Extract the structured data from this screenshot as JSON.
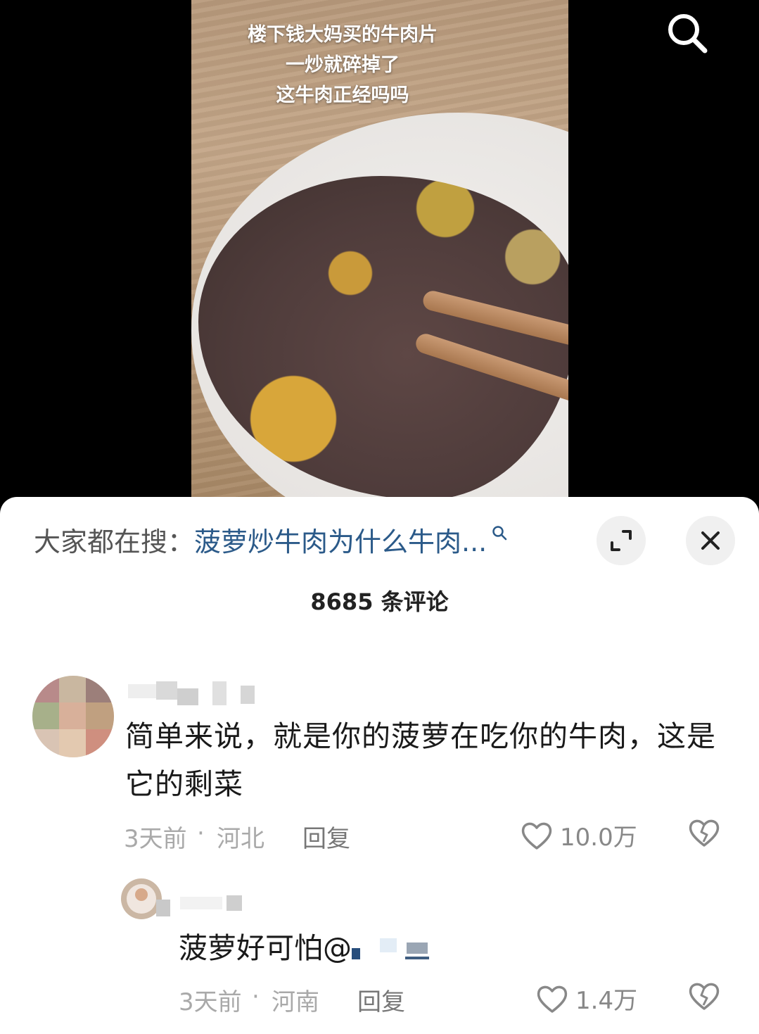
{
  "video": {
    "caption_lines": [
      "楼下钱大妈买的牛肉片",
      "一炒就碎掉了",
      "这牛肉正经吗吗"
    ]
  },
  "search_bar": {
    "prefix": "大家都在搜：",
    "query": "菠萝炒牛肉为什么牛肉..."
  },
  "comments_header": {
    "count_text": "8685 条评论"
  },
  "comments": [
    {
      "text": "简单来说，就是你的菠萝在吃你的牛肉，这是它的剩菜",
      "time": "3天前",
      "location": "河北",
      "reply_label": "回复",
      "likes": "10.0万"
    }
  ],
  "replies": [
    {
      "text": "菠萝好可怕@",
      "time": "3天前",
      "location": "河南",
      "reply_label": "回复",
      "likes": "1.4万"
    }
  ],
  "meta_separator": "·",
  "colors": {
    "search_link": "#2b5a89",
    "meta_gray": "#a9a9a9",
    "sheet_bg": "#ffffff",
    "video_bg": "#000000"
  }
}
